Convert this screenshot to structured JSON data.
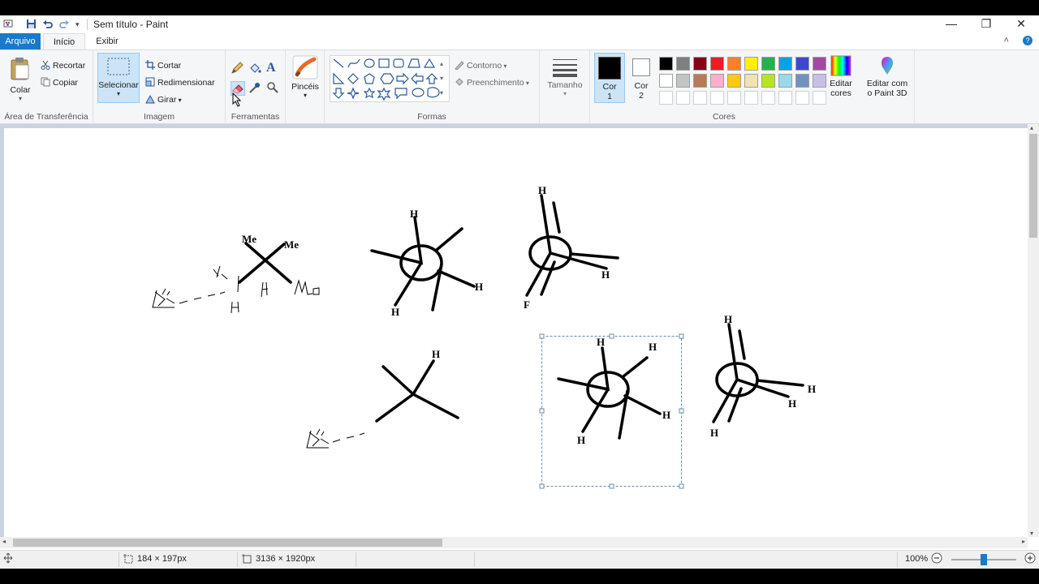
{
  "title_bar": {
    "title": "Sem título - Paint",
    "minimize": "—",
    "maximize": "❐",
    "close": "✕"
  },
  "tabs": {
    "file": "Arquivo",
    "home": "Início",
    "view": "Exibir"
  },
  "ribbon": {
    "clipboard": {
      "label": "Área de Transferência",
      "paste": "Colar",
      "cut": "Recortar",
      "copy": "Copiar"
    },
    "image": {
      "label": "Imagem",
      "select": "Selecionar",
      "crop": "Cortar",
      "resize": "Redimensionar",
      "rotate": "Girar"
    },
    "tools": {
      "label": "Ferramentas"
    },
    "brushes": {
      "label": "Pincéis"
    },
    "shapes": {
      "label": "Formas",
      "outline": "Contorno",
      "fill": "Preenchimento"
    },
    "size": {
      "label": "Tamanho"
    },
    "colors": {
      "label": "Cores",
      "color1_label": "Cor",
      "color1_num": "1",
      "color2_label": "Cor",
      "color2_num": "2",
      "edit_colors_l1": "Editar",
      "edit_colors_l2": "cores",
      "paint3d_l1": "Editar com",
      "paint3d_l2": "o Paint 3D",
      "color1_value": "#000000",
      "color2_value": "#ffffff",
      "palette_row1": [
        "#000000",
        "#7f7f7f",
        "#880015",
        "#ed1c24",
        "#ff7f27",
        "#fff200",
        "#22b14c",
        "#00a2e8",
        "#3f48cc",
        "#a349a4"
      ],
      "palette_row2": [
        "#ffffff",
        "#c3c3c3",
        "#b97a57",
        "#ffaec9",
        "#ffc90e",
        "#efe4b0",
        "#b5e61d",
        "#99d9ea",
        "#7092be",
        "#c8bfe7"
      ]
    }
  },
  "drawing": {
    "label_me": "Me",
    "label_h": "H",
    "label_f": "F",
    "hand_h": "H",
    "hand_me": "Mo",
    "hand_eye": "Vo"
  },
  "status": {
    "selection_size": "184 × 197px",
    "image_size": "3136 × 1920px",
    "zoom": "100%",
    "zoom_level": 0.5
  }
}
